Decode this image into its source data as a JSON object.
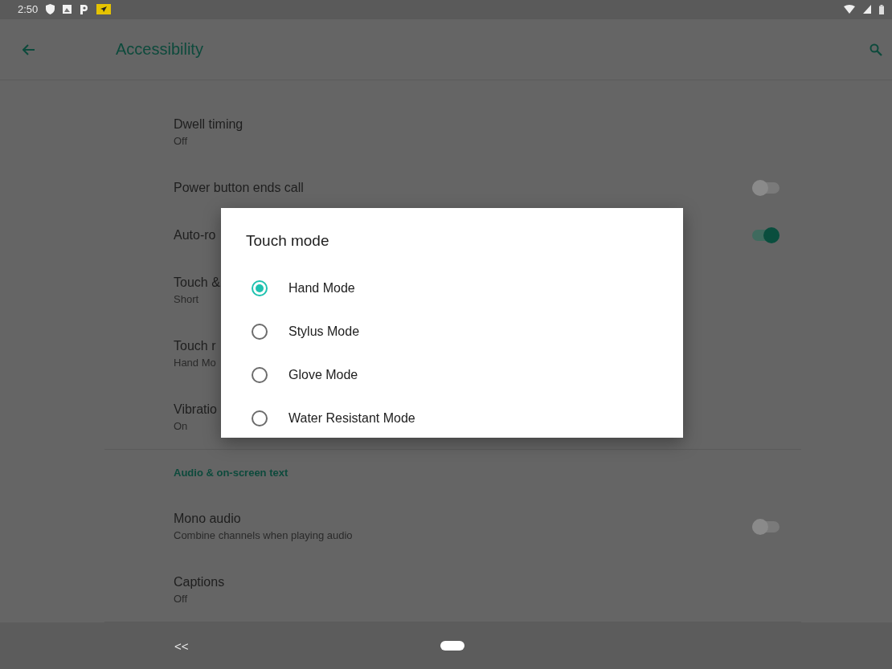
{
  "status_bar": {
    "time": "2:50"
  },
  "app_bar": {
    "title": "Accessibility"
  },
  "settings": [
    {
      "kind": "item",
      "title": "Dwell timing",
      "summary": "Off"
    },
    {
      "kind": "switch",
      "title": "Power button ends call",
      "on": false
    },
    {
      "kind": "switch",
      "title": "Auto-ro",
      "on": true
    },
    {
      "kind": "item",
      "title": "Touch &",
      "summary": "Short"
    },
    {
      "kind": "item",
      "title": "Touch r",
      "summary": "Hand Mo"
    },
    {
      "kind": "item",
      "title": "Vibratio",
      "summary": "On"
    },
    {
      "kind": "header",
      "title": "Audio & on-screen text"
    },
    {
      "kind": "switch",
      "title": "Mono audio",
      "summary": "Combine channels when playing audio",
      "on": false
    },
    {
      "kind": "item",
      "title": "Captions",
      "summary": "Off"
    }
  ],
  "dialog": {
    "title": "Touch mode",
    "options": [
      {
        "label": "Hand Mode",
        "selected": true
      },
      {
        "label": "Stylus Mode",
        "selected": false
      },
      {
        "label": "Glove Mode",
        "selected": false
      },
      {
        "label": "Water Resistant Mode",
        "selected": false
      }
    ]
  },
  "nav_bar": {
    "back": "<<"
  }
}
